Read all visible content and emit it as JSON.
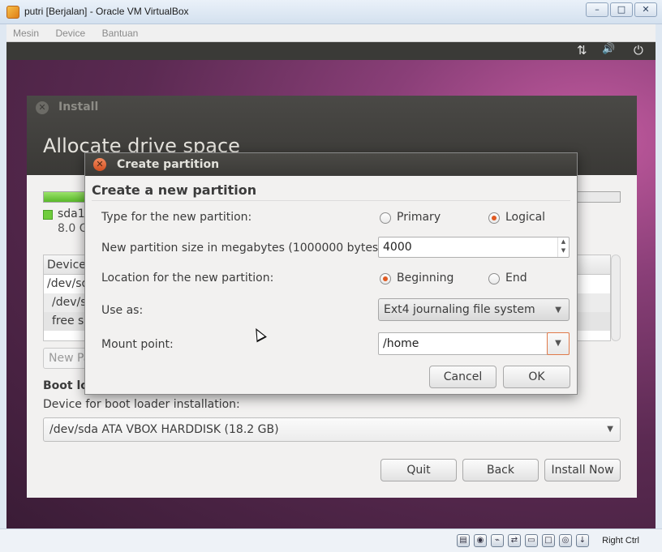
{
  "vbox": {
    "title": "putri [Berjalan] - Oracle VM VirtualBox",
    "menu": [
      "Mesin",
      "Device",
      "Bantuan"
    ],
    "window_buttons": [
      "–",
      "□",
      "✕"
    ],
    "host_key": "Right Ctrl"
  },
  "ubuntu_panel": {
    "network_icon": "⇅",
    "volume_icon": "🔊",
    "power_icon": "⏻"
  },
  "installer": {
    "title": "Install",
    "heading": "Allocate drive space",
    "partition_bar_fill": 0.75,
    "legend_name": "sda1",
    "legend_size": "8.0 G",
    "table_header": "Device",
    "table_rows": [
      "/dev/sd",
      "/dev/s",
      "free sp"
    ],
    "new_partition_button": "New Pa",
    "boot_label": "Boot lo",
    "device_label": "Device for boot loader installation:",
    "device_value": "/dev/sda ATA VBOX HARDDISK (18.2 GB)",
    "quit_button": "Quit",
    "back_button": "Back",
    "install_button": "Install Now"
  },
  "dialog": {
    "title": "Create partition",
    "heading": "Create a new partition",
    "type_label": "Type for the new partition:",
    "type_primary": "Primary",
    "type_logical": "Logical",
    "type_selected": "Logical",
    "size_label": "New partition size in megabytes (1000000 bytes):",
    "size_value": "4000",
    "location_label": "Location for the new partition:",
    "location_beginning": "Beginning",
    "location_end": "End",
    "location_selected": "Beginning",
    "use_as_label": "Use as:",
    "use_as_value": "Ext4 journaling file system",
    "mount_label": "Mount point:",
    "mount_value": "/home",
    "cancel_button": "Cancel",
    "ok_button": "OK"
  },
  "colors": {
    "accent_radio": "#e05a22",
    "partition_green": "#6fcc3c"
  }
}
